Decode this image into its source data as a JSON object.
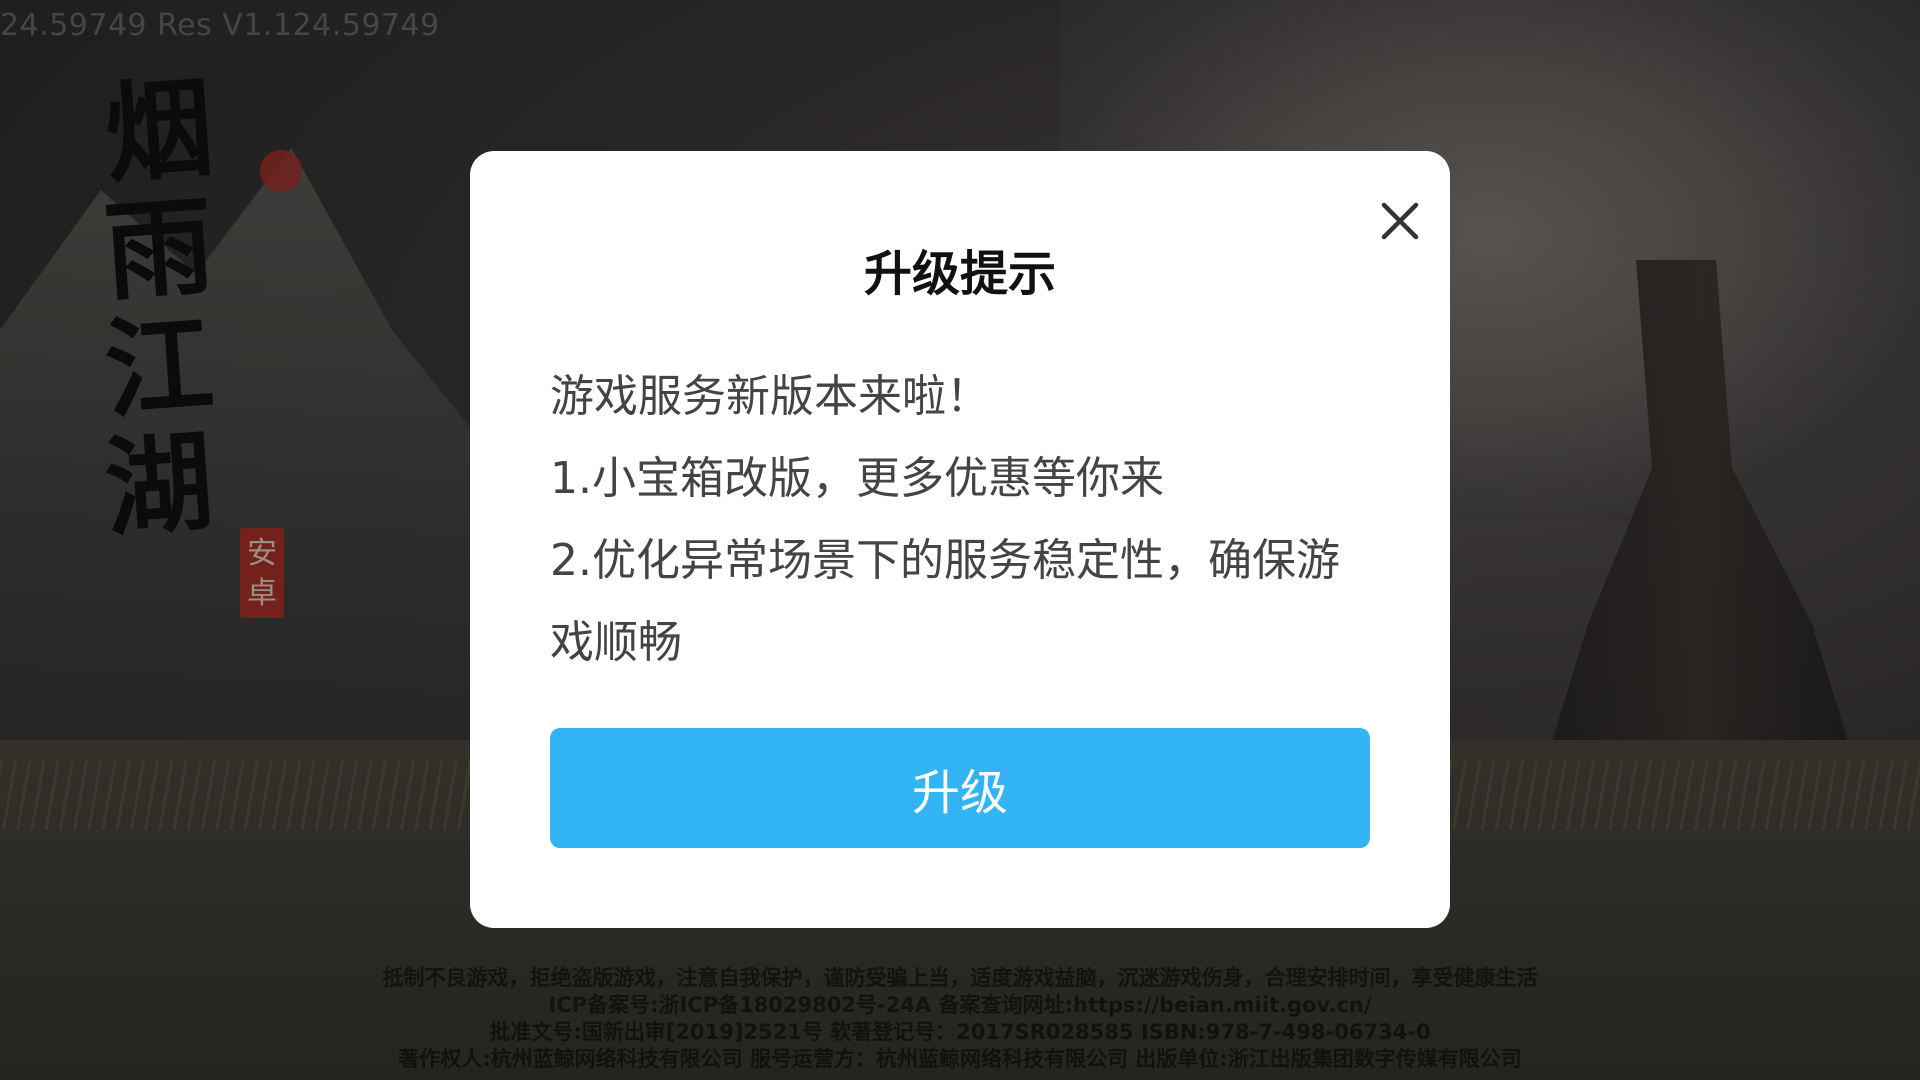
{
  "background": {
    "version_text": "24.59749  Res V1.124.59749",
    "logo": {
      "chars": [
        "烟",
        "雨",
        "江",
        "湖"
      ],
      "seal_text": "安卓"
    },
    "legal_lines": [
      "抵制不良游戏，拒绝盗版游戏，注意自我保护，谨防受骗上当，适度游戏益脑，沉迷游戏伤身，合理安排时间，享受健康生活",
      "ICP备案号:浙ICP备18029802号-24A  备案查询网址:https://beian.miit.gov.cn/",
      "批准文号:国新出审[2019]2521号  软著登记号：2017SR028585  ISBN:978-7-498-06734-0",
      "著作权人:杭州蓝鲸网络科技有限公司  服号运营方：杭州蓝鲸网络科技有限公司  出版单位:浙江出版集团数字传媒有限公司"
    ]
  },
  "dialog": {
    "title": "升级提示",
    "close_icon": "close-icon",
    "body_lines": [
      "游戏服务新版本来啦！",
      "1.小宝箱改版，更多优惠等你来",
      "2.优化异常场景下的服务稳定性，确保游戏顺畅"
    ],
    "upgrade_label": "升级"
  },
  "colors": {
    "accent": "#33b5f5",
    "dialog_bg": "#ffffff",
    "seal": "#b2332b"
  }
}
